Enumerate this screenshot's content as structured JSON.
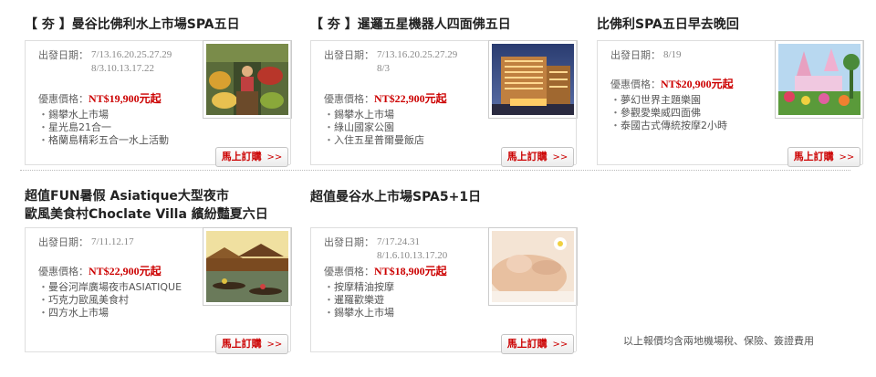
{
  "labels": {
    "date": "出發日期：",
    "price": "優惠價格：",
    "book": "馬上訂購",
    "arrow": ">>"
  },
  "tours": [
    {
      "tag": "【 夯 】",
      "title": "曼谷比佛利水上市場SPA五日",
      "dates": [
        "7/13.16.20.25.27.29",
        "8/3.10.13.17.22"
      ],
      "price": "NT$19,900元起",
      "features": [
        "錫攀水上市場",
        "星光島21合一",
        "格蘭島精彩五合一水上活動"
      ],
      "image": "floating-market-photo"
    },
    {
      "tag": "【 夯 】",
      "title": "暹邏五星機器人四面佛五日",
      "dates": [
        "7/13.16.20.25.27.29",
        "8/3"
      ],
      "price": "NT$22,900元起",
      "features": [
        "錫攀水上市場",
        "綠山國家公園",
        "入住五星普爾曼飯店"
      ],
      "image": "hotel-night-photo"
    },
    {
      "tag": "",
      "title": "比佛利SPA五日早去晚回",
      "dates": [
        "8/19"
      ],
      "price": "NT$20,900元起",
      "features": [
        "夢幻世界主題樂園",
        "參觀愛樂威四面佛",
        "泰國古式傳統按摩2小時"
      ],
      "image": "theme-park-photo"
    },
    {
      "tag": "",
      "title": "超值FUN暑假 Asiatique大型夜市",
      "title2": "歐風美食村Choclate Villa 繽紛豔夏六日",
      "dates": [
        "7/11.12.17"
      ],
      "price": "NT$22,900元起",
      "features": [
        "曼谷河岸廣場夜市ASIATIQUE",
        "巧克力歐風美食村",
        "四方水上市場"
      ],
      "image": "floating-market-boats-photo"
    },
    {
      "tag": "",
      "title": "超值曼谷水上市場SPA5+1日",
      "dates": [
        "7/17.24.31",
        "8/1.6.10.13.17.20"
      ],
      "price": "NT$18,900元起",
      "features": [
        "按摩精油按摩",
        "暹羅歡樂遊",
        "錫攀水上市場"
      ],
      "image": "spa-massage-photo"
    }
  ],
  "note": "以上報價均含兩地機場稅、保險、簽證費用"
}
